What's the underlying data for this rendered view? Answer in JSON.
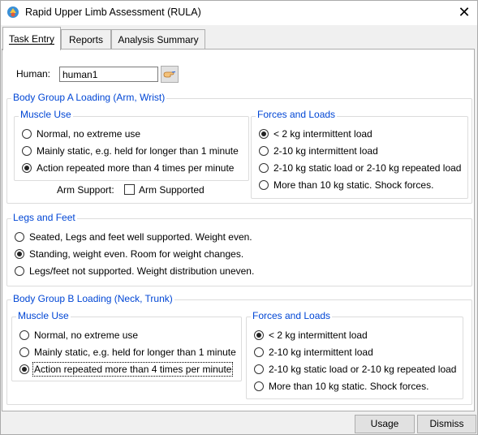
{
  "window": {
    "title": "Rapid Upper Limb Assessment (RULA)",
    "close_glyph": "✕"
  },
  "tabs": [
    {
      "label": "Task Entry",
      "active": true
    },
    {
      "label": "Reports",
      "active": false
    },
    {
      "label": "Analysis Summary",
      "active": false
    }
  ],
  "human": {
    "label": "Human:",
    "value": "human1"
  },
  "group_a": {
    "title": "Body Group A Loading (Arm, Wrist)",
    "muscle_use": {
      "title": "Muscle Use",
      "options": [
        {
          "label": "Normal, no extreme use",
          "selected": false
        },
        {
          "label": "Mainly static, e.g. held for longer than 1 minute",
          "selected": false
        },
        {
          "label": "Action repeated more than 4 times per minute",
          "selected": true
        }
      ]
    },
    "forces": {
      "title": "Forces and Loads",
      "options": [
        {
          "label": "< 2 kg intermittent load",
          "selected": true
        },
        {
          "label": "2-10 kg intermittent load",
          "selected": false
        },
        {
          "label": "2-10 kg static load or 2-10 kg repeated load",
          "selected": false
        },
        {
          "label": "More than 10 kg static.  Shock forces.",
          "selected": false
        }
      ]
    },
    "arm_support": {
      "label": "Arm Support:",
      "checkbox_label": "Arm Supported",
      "checked": false
    }
  },
  "legs": {
    "title": "Legs and Feet",
    "options": [
      {
        "label": "Seated, Legs and feet well supported.  Weight even.",
        "selected": false
      },
      {
        "label": "Standing, weight even.  Room for weight changes.",
        "selected": true
      },
      {
        "label": "Legs/feet not supported.  Weight distribution uneven.",
        "selected": false
      }
    ]
  },
  "group_b": {
    "title": "Body Group B Loading (Neck, Trunk)",
    "muscle_use": {
      "title": "Muscle Use",
      "options": [
        {
          "label": "Normal, no extreme use",
          "selected": false
        },
        {
          "label": "Mainly static, e.g. held for longer than 1 minute",
          "selected": false
        },
        {
          "label": "Action repeated more than 4 times per minute",
          "selected": true
        }
      ]
    },
    "forces": {
      "title": "Forces and Loads",
      "options": [
        {
          "label": "< 2 kg intermittent load",
          "selected": true
        },
        {
          "label": "2-10 kg intermittent load",
          "selected": false
        },
        {
          "label": "2-10 kg static load or 2-10 kg repeated load",
          "selected": false
        },
        {
          "label": "More than 10 kg static.  Shock forces.",
          "selected": false
        }
      ]
    }
  },
  "buttons": {
    "usage": "Usage",
    "dismiss": "Dismiss"
  },
  "colors": {
    "group_title": "#0046d5",
    "panel_bg": "#ffffff",
    "window_bg": "#f0f0f0"
  },
  "icons": {
    "app": "rula-app-icon",
    "pick": "pick-hand-icon"
  }
}
